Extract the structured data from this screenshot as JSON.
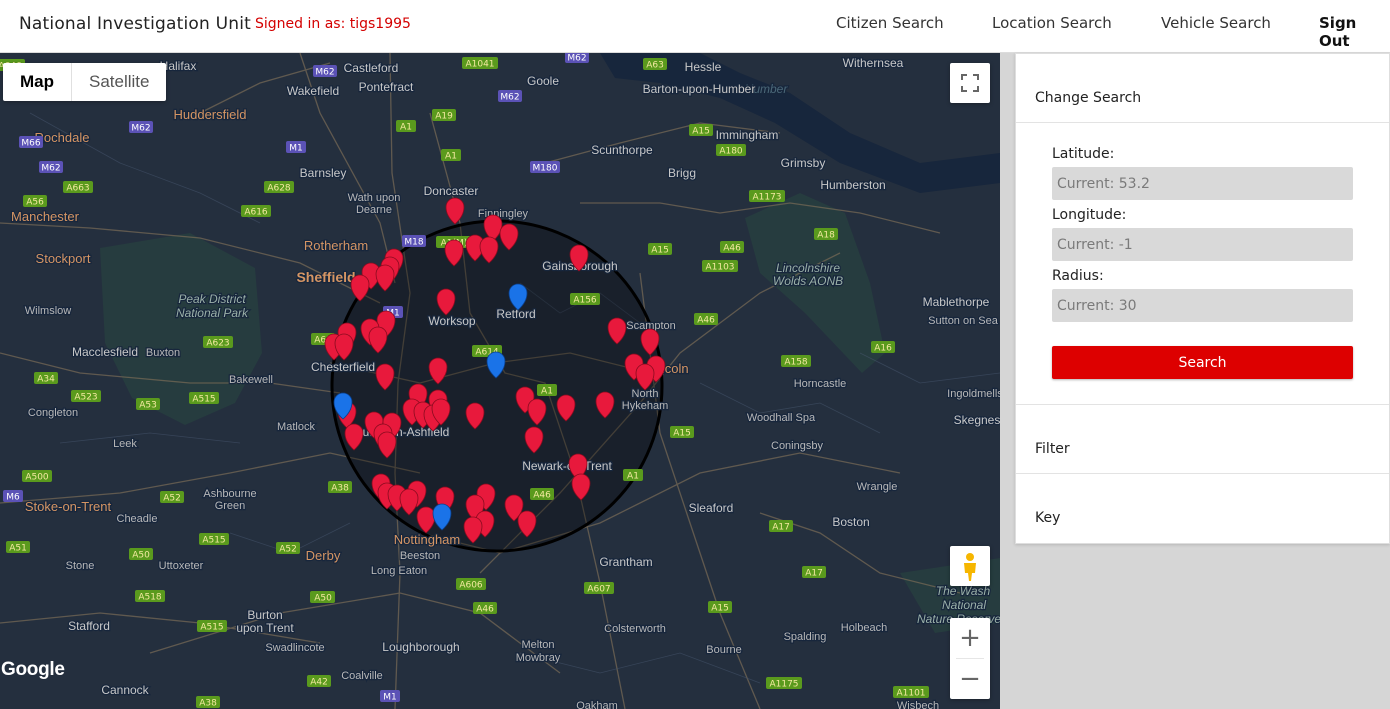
{
  "header": {
    "brand": "National Investigation Unit",
    "signed_in": "Signed in as: tigs1995",
    "nav": [
      "Citizen Search",
      "Location Search",
      "Vehicle Search"
    ],
    "sign_out": "Sign Out"
  },
  "map": {
    "type_map": "Map",
    "type_satellite": "Satellite",
    "google": "Google",
    "labels": [
      {
        "t": "Halifax",
        "k": "town"
      },
      {
        "t": "Castleford",
        "k": "town"
      },
      {
        "t": "Goole",
        "k": "town"
      },
      {
        "t": "Hessle",
        "k": "town"
      },
      {
        "t": "Withernsea",
        "k": "town"
      },
      {
        "t": "Humber",
        "k": "water"
      },
      {
        "t": "Wakefield",
        "k": "town"
      },
      {
        "t": "Pontefract",
        "k": "town"
      },
      {
        "t": "Barton-upon-Humber",
        "k": "town"
      },
      {
        "t": "Huddersfield",
        "k": "city"
      },
      {
        "t": "Rochdale",
        "k": "city"
      },
      {
        "t": "Immingham",
        "k": "town"
      },
      {
        "t": "Scunthorpe",
        "k": "town"
      },
      {
        "t": "Grimsby",
        "k": "town"
      },
      {
        "t": "Barnsley",
        "k": "town"
      },
      {
        "t": "Brigg",
        "k": "town"
      },
      {
        "t": "Humberston",
        "k": "town"
      },
      {
        "t": "Wath upon",
        "k": "small"
      },
      {
        "t": "Dearne",
        "k": "small"
      },
      {
        "t": "Doncaster",
        "k": "town"
      },
      {
        "t": "Manchester",
        "k": "city"
      },
      {
        "t": "Finningley",
        "k": "small"
      },
      {
        "t": "Rotherham",
        "k": "city"
      },
      {
        "t": "Stockport",
        "k": "city"
      },
      {
        "t": "Gainsborough",
        "k": "town"
      },
      {
        "t": "Lincolnshire",
        "k": "park"
      },
      {
        "t": "Wolds AONB",
        "k": "park"
      },
      {
        "t": "Sheffield",
        "k": "big"
      },
      {
        "t": "Peak District",
        "k": "park"
      },
      {
        "t": "National Park",
        "k": "park"
      },
      {
        "t": "Retford",
        "k": "town"
      },
      {
        "t": "Mablethorpe",
        "k": "town"
      },
      {
        "t": "Wilmslow",
        "k": "small"
      },
      {
        "t": "Worksop",
        "k": "town"
      },
      {
        "t": "Sutton on Sea",
        "k": "small"
      },
      {
        "t": "Scampton",
        "k": "small"
      },
      {
        "t": "Macclesfield",
        "k": "town"
      },
      {
        "t": "Buxton",
        "k": "small"
      },
      {
        "t": "Chesterfield",
        "k": "town"
      },
      {
        "t": "Lincoln",
        "k": "city"
      },
      {
        "t": "Horncastle",
        "k": "small"
      },
      {
        "t": "Bakewell",
        "k": "small"
      },
      {
        "t": "North",
        "k": "small"
      },
      {
        "t": "Hykeham",
        "k": "small"
      },
      {
        "t": "Ingoldmells",
        "k": "small"
      },
      {
        "t": "Congleton",
        "k": "small"
      },
      {
        "t": "Woodhall Spa",
        "k": "small"
      },
      {
        "t": "Skegness",
        "k": "town"
      },
      {
        "t": "Matlock",
        "k": "small"
      },
      {
        "t": "Sutton-in-Ashfield",
        "k": "town"
      },
      {
        "t": "Leek",
        "k": "small"
      },
      {
        "t": "Coningsby",
        "k": "small"
      },
      {
        "t": "Newark-on-Trent",
        "k": "town"
      },
      {
        "t": "Ashbourne",
        "k": "small"
      },
      {
        "t": "Green",
        "k": "small"
      },
      {
        "t": "Wrangle",
        "k": "small"
      },
      {
        "t": "Stoke-on-Trent",
        "k": "city"
      },
      {
        "t": "Cheadle",
        "k": "small"
      },
      {
        "t": "Sleaford",
        "k": "town"
      },
      {
        "t": "Boston",
        "k": "town"
      },
      {
        "t": "Nottingham",
        "k": "city"
      },
      {
        "t": "Derby",
        "k": "city"
      },
      {
        "t": "Beeston",
        "k": "small"
      },
      {
        "t": "Stone",
        "k": "small"
      },
      {
        "t": "Long Eaton",
        "k": "small"
      },
      {
        "t": "Grantham",
        "k": "town"
      },
      {
        "t": "Uttoxeter",
        "k": "small"
      },
      {
        "t": "The Wash",
        "k": "park"
      },
      {
        "t": "National",
        "k": "park"
      },
      {
        "t": "Nature Reserve",
        "k": "park"
      },
      {
        "t": "Burton",
        "k": "town"
      },
      {
        "t": "upon Trent",
        "k": "town"
      },
      {
        "t": "Stafford",
        "k": "town"
      },
      {
        "t": "Spalding",
        "k": "small"
      },
      {
        "t": "Holbeach",
        "k": "small"
      },
      {
        "t": "Colsterworth",
        "k": "small"
      },
      {
        "t": "Swadlincote",
        "k": "small"
      },
      {
        "t": "Loughborough",
        "k": "town"
      },
      {
        "t": "Melton",
        "k": "small"
      },
      {
        "t": "Mowbray",
        "k": "small"
      },
      {
        "t": "Bourne",
        "k": "small"
      },
      {
        "t": "Coalville",
        "k": "small"
      },
      {
        "t": "Cannock",
        "k": "town"
      },
      {
        "t": "Oakham",
        "k": "small"
      },
      {
        "t": "Wisbech",
        "k": "small"
      }
    ],
    "roads": [
      "A646",
      "M62",
      "A1041",
      "M62",
      "A63",
      "M62",
      "A19",
      "A1",
      "A1",
      "A15",
      "M66",
      "M62",
      "A180",
      "M1",
      "M180",
      "M62",
      "A663",
      "A628",
      "A1173",
      "A56",
      "A616",
      "A18",
      "M18",
      "A1(M)",
      "A15",
      "A46",
      "A1103",
      "A156",
      "M1",
      "A46",
      "A61",
      "A623",
      "A614",
      "A158",
      "A16",
      "A34",
      "A1",
      "A53",
      "A515",
      "A523",
      "A15",
      "A500",
      "A1",
      "A52",
      "A38",
      "M6",
      "A46",
      "A17",
      "A515",
      "A52",
      "A51",
      "A50",
      "A52",
      "A606",
      "A607",
      "A17",
      "A518",
      "A50",
      "A46",
      "A15",
      "A515",
      "A42",
      "A1175",
      "A1101",
      "A38",
      "M1"
    ]
  },
  "panel": {
    "change_search": "Change Search",
    "latitude_label": "Latitude:",
    "latitude_placeholder": "Current: 53.2",
    "longitude_label": "Longitude:",
    "longitude_placeholder": "Current: -1",
    "radius_label": "Radius:",
    "radius_placeholder": "Current: 30",
    "search_button": "Search",
    "filter": "Filter",
    "key": "Key"
  },
  "colors": {
    "map_bg": "#242f3e",
    "marker_red": "#e8193c",
    "marker_blue": "#1a73e8",
    "search_button": "#dd0000",
    "signed_in_text": "#d40000"
  }
}
